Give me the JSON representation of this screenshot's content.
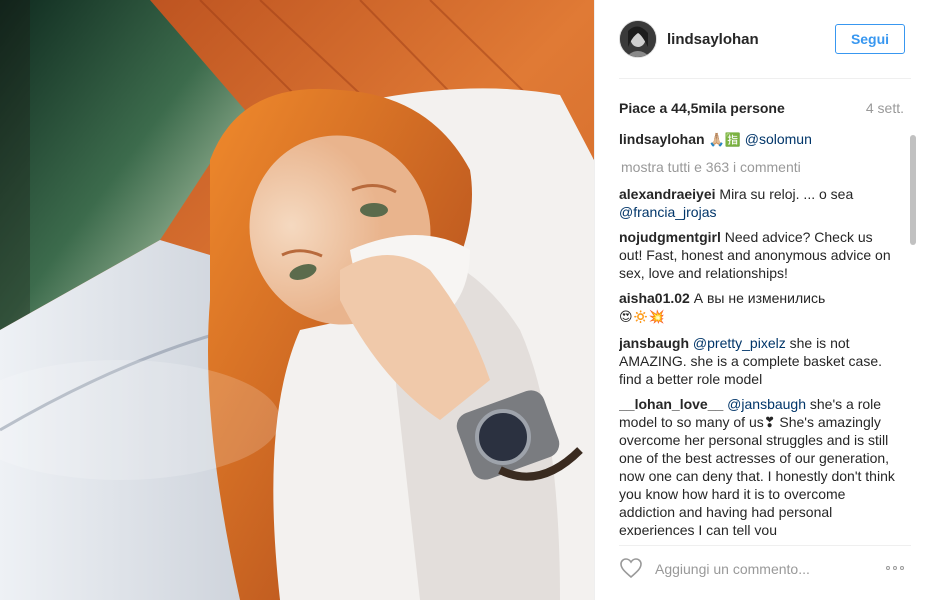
{
  "post": {
    "username": "lindsaylohan",
    "follow_label": "Segui",
    "likes_text": "Piace a 44,5mila persone",
    "time_ago": "4 sett.",
    "caption": {
      "user": "lindsaylohan",
      "emoji": "🙏🏼🈯",
      "mention": "@solomun"
    },
    "view_all_text": "mostra tutti e 363 i commenti",
    "comments": [
      {
        "user": "alexandraeiyei",
        "text_before": "Mira su reloj. ... o sea",
        "mention": "@francia_jrojas",
        "text_after": ""
      },
      {
        "user": "nojudgmentgirl",
        "text_before": "Need advice? Check us out! Fast, honest and anonymous advice on sex, love and relationships!",
        "mention": "",
        "text_after": ""
      },
      {
        "user": "aisha01.02",
        "text_before": "А вы не изменились",
        "emoji": "😍🔅💥",
        "mention": "",
        "text_after": ""
      },
      {
        "user": "jansbaugh",
        "text_before": "",
        "mention": "@pretty_pixelz",
        "text_after": "she is not AMAZING. she is a complete basket case. find a better role model"
      },
      {
        "user": "__lohan_love__",
        "text_before": "",
        "mention": "@jansbaugh",
        "text_after": "she's a role model to so many of us❣ She's amazingly overcome her personal struggles and is still one of the best actresses of our generation, now one can deny that. I honestly don't think you know how hard it is to overcome addiction and having had personal experiences I can tell you"
      }
    ],
    "add_comment_placeholder": "Aggiungi un commento..."
  },
  "icons": {
    "heart": "heart-icon",
    "more": "more-options-icon"
  },
  "colors": {
    "link": "#003569",
    "button_blue": "#3897f0",
    "muted": "#999999"
  }
}
